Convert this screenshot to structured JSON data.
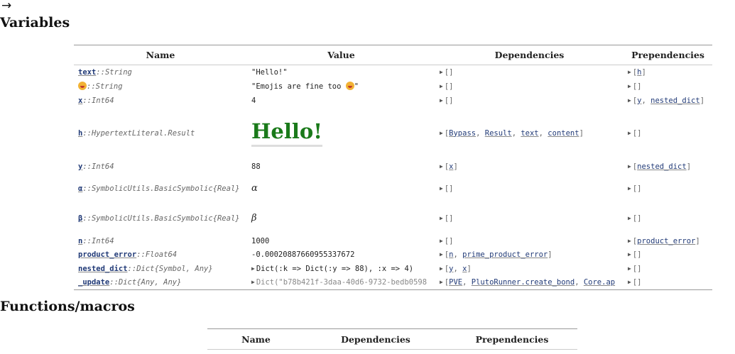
{
  "nav_arrow": "→",
  "variables": {
    "heading": "Variables",
    "headers": {
      "name": "Name",
      "value": "Value",
      "dependencies": "Dependencies",
      "prependencies": "Prependencies"
    },
    "rows": [
      {
        "name": "text",
        "type": "::String",
        "value": "\"Hello!\"",
        "deps": [],
        "preps": [
          "h"
        ]
      },
      {
        "name": "😜",
        "type": "::String",
        "value": "\"Emojis are fine too 😜\"",
        "deps": [],
        "preps": []
      },
      {
        "name": "x",
        "type": "::Int64",
        "value": "4",
        "deps": [],
        "preps": [
          "y",
          "nested_dict"
        ]
      },
      {
        "name": "h",
        "type": "::HypertextLiteral.Result",
        "value": "Hello!",
        "deps": [
          "Bypass",
          "Result",
          "text",
          "content"
        ],
        "preps": []
      },
      {
        "name": "y",
        "type": "::Int64",
        "value": "88",
        "deps": [
          "x"
        ],
        "preps": [
          "nested_dict"
        ]
      },
      {
        "name": "α",
        "type": "::SymbolicUtils.BasicSymbolic{Real}",
        "value": "α",
        "deps": [],
        "preps": []
      },
      {
        "name": "β",
        "type": "::SymbolicUtils.BasicSymbolic{Real}",
        "value": "β",
        "deps": [],
        "preps": []
      },
      {
        "name": "n",
        "type": "::Int64",
        "value": "1000",
        "deps": [],
        "preps": [
          "product_error"
        ]
      },
      {
        "name": "product_error",
        "type": "::Float64",
        "value": "-0.00020887660955337672",
        "deps": [
          "n",
          "prime_product_error"
        ],
        "preps": []
      },
      {
        "name": "nested_dict",
        "type": "::Dict{Symbol, Any}",
        "value": "Dict(:k => Dict(:y => 88), :x => 4)",
        "deps": [
          "y",
          "x"
        ],
        "preps": []
      },
      {
        "name": "_update",
        "type": "::Dict{Any, Any}",
        "value": "Dict(\"b78b421f-3daa-40d6-9732-bedb0598",
        "deps": [
          "PVE",
          "PlutoRunner.create_bond",
          "Core.ap"
        ],
        "preps": []
      }
    ]
  },
  "functions": {
    "heading": "Functions/macros",
    "headers": {
      "name": "Name",
      "dependencies": "Dependencies",
      "prependencies": "Prependencies"
    }
  }
}
